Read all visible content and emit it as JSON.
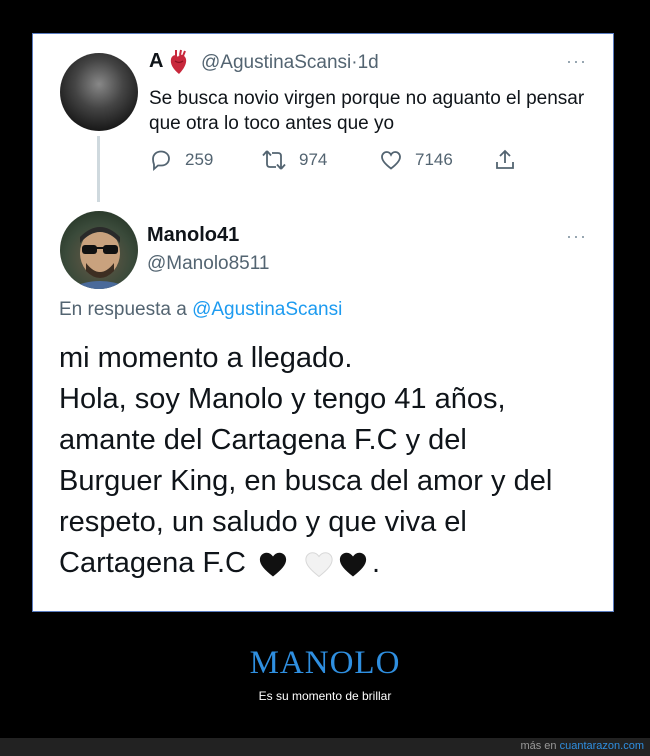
{
  "tweet1": {
    "display_name": "A",
    "name_emoji_icon": "anatomical-heart",
    "handle": "@AgustinaScansi",
    "separator": "·",
    "time": "1d",
    "more": "···",
    "text": "Se busca novio virgen porque no aguanto el pensar que otra lo toco antes que yo",
    "stats": {
      "replies": "259",
      "retweets": "974",
      "likes": "7146"
    }
  },
  "tweet2": {
    "display_name": "Manolo41",
    "handle": "@Manolo8511",
    "more": "···",
    "reply_prefix": "En respuesta a",
    "reply_to": "@AgustinaScansi",
    "lines": [
      "mi momento a llegado.",
      "Hola, soy Manolo y tengo 41 años,",
      "amante del Cartagena F.C y del",
      "Burguer King, en busca del amor y del",
      "respeto, un saludo y que viva el",
      "Cartagena F.C"
    ],
    "hearts": [
      "black-heart",
      "white-heart",
      "black-heart"
    ],
    "end_punct": "."
  },
  "caption": {
    "title": "MANOLO",
    "subtitle": "Es su momento de brillar"
  },
  "footer": {
    "prefix": "más en",
    "site": "cuantarazon.com"
  },
  "colors": {
    "link": "#1d9bf0",
    "caption_title": "#2f8fe0",
    "frame_border": "#5a7cc0"
  }
}
